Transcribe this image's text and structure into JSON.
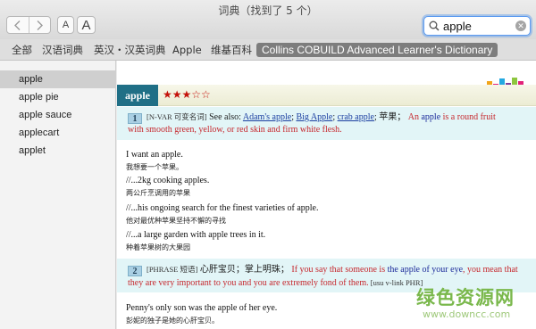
{
  "window": {
    "title": "词典（找到了 5 个）"
  },
  "toolbar": {
    "font_small": "A",
    "font_large": "A"
  },
  "search": {
    "value": "apple"
  },
  "tabs": [
    "全部",
    "汉语词典",
    "英汉・汉英词典",
    "Apple",
    "维基百科",
    "Collins COBUILD Advanced Learner's Dictionary"
  ],
  "results": [
    "apple",
    "apple pie",
    "apple sauce",
    "applecart",
    "applet"
  ],
  "entry": {
    "headword": "apple",
    "stars": "★★★☆☆",
    "sense1": {
      "num": "1",
      "gram": "[N-VAR 可变名词]",
      "see_also": " See also: ",
      "links": [
        "Adam's apple",
        "Big Apple",
        "crab apple"
      ],
      "sep1": "; ",
      "sep2": "; ",
      "sep3": ";",
      "cn": " 苹果；",
      "def_a": " An ",
      "def_b": "apple",
      "def_c": " is a round fruit",
      "def_line2": "with smooth green, yellow, or red skin and firm white flesh."
    },
    "examples1": [
      {
        "en": "I want an apple.",
        "cn": "我想要一个苹果。"
      },
      {
        "en": "//...2kg cooking apples.",
        "cn": "两公斤烹调用的苹果"
      },
      {
        "en": "//...his ongoing search for the finest varieties of apple.",
        "cn": "他对最优种苹果坚持不懈的寻找"
      },
      {
        "en": "//...a large garden with apple trees in it.",
        "cn": "种着苹果树的大果园"
      }
    ],
    "sense2": {
      "num": "2",
      "gram": "[PHRASE 短语]",
      "cn": " 心肝宝贝；掌上明珠；",
      "def_a": " If you say that someone is ",
      "def_b": "the apple of your eye",
      "def_c": ", you mean that",
      "def_line2": "they are very important to you and you are extremely fond of them.",
      "usage": " [usu v-link PHR]"
    },
    "examples2": [
      {
        "en": "Penny's only son was the apple of her eye.",
        "cn": "彭妮的独子是她的心肝宝贝。"
      }
    ]
  },
  "watermark": {
    "main": "绿色资源网",
    "url": "www.downcc.com"
  },
  "colors": {
    "headword_bg": "#1f6f86",
    "definition_red": "#c6282e",
    "keyword_blue": "#1c2a9a",
    "sense_bg": "#e2f5f7",
    "active_tab_bg": "#7d7d7d",
    "watermark_green": "#7ab84c",
    "deco_colors": [
      "#f2a51a",
      "#e2227a",
      "#23a9e1",
      "#8dc63f",
      "#e2227a",
      "#7b3f9e"
    ]
  }
}
